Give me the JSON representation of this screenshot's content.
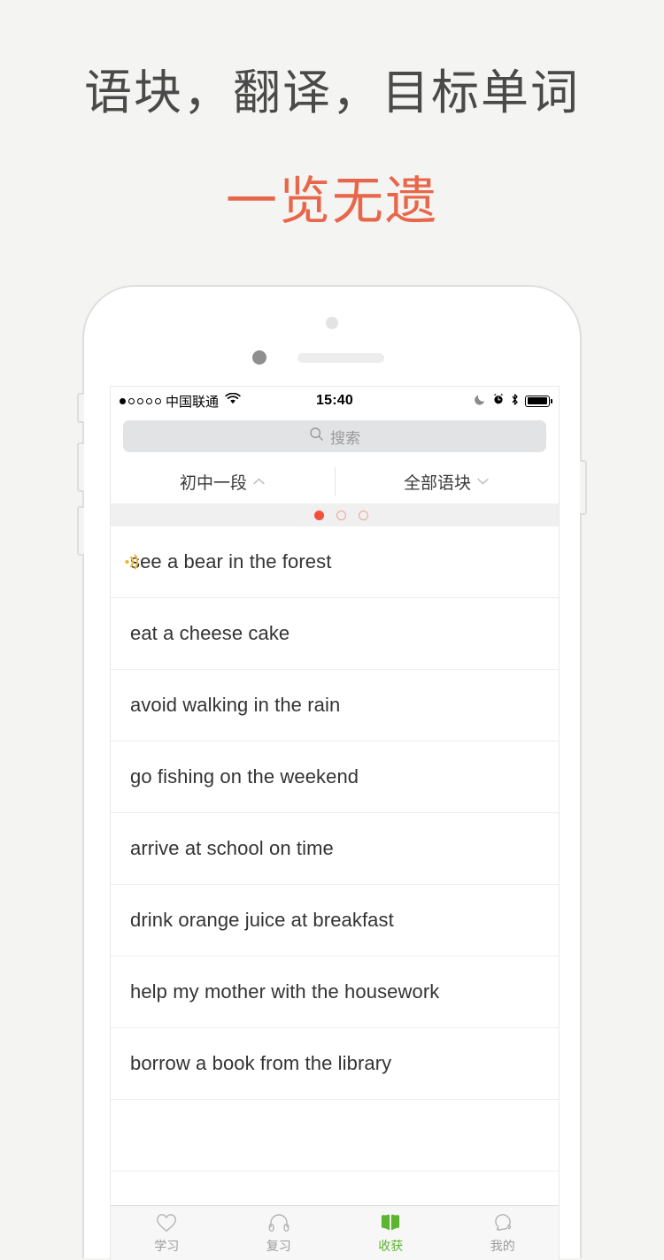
{
  "promo": {
    "line1": "语块，翻译，目标单词",
    "line2": "一览无遗",
    "heading_color": "#4a4a4a",
    "accent_color": "#e8674a"
  },
  "statusbar": {
    "carrier": "中国联通",
    "signal_dots_filled": 1,
    "signal_dots_total": 5,
    "wifi": "wifi-icon",
    "time": "15:40",
    "icons": [
      "moon-icon",
      "alarm-clock-icon",
      "bluetooth-icon",
      "battery-icon"
    ],
    "battery_level": "85"
  },
  "search": {
    "placeholder": "搜索",
    "value": "",
    "icon": "search-icon"
  },
  "filters": [
    {
      "label": "初中一段",
      "chevron": "chevron-up-icon"
    },
    {
      "label": "全部语块",
      "chevron": "chevron-down-icon"
    }
  ],
  "pager": {
    "total": 3,
    "active_index": 0,
    "active_color": "#f4503c",
    "idle_border_color": "#f0a193"
  },
  "list": {
    "items": [
      {
        "text": "see a bear in the forest",
        "speaker": true
      },
      {
        "text": "eat a cheese cake",
        "speaker": false
      },
      {
        "text": "avoid walking in the rain",
        "speaker": false
      },
      {
        "text": "go fishing on the weekend",
        "speaker": false
      },
      {
        "text": "arrive at school on time",
        "speaker": false
      },
      {
        "text": "drink orange juice at breakfast",
        "speaker": false
      },
      {
        "text": "help my mother with the housework",
        "speaker": false
      },
      {
        "text": "borrow a book from the library",
        "speaker": false
      }
    ]
  },
  "tabbar": {
    "active_color": "#5cb531",
    "inactive_color": "#9b9b9b",
    "tabs": [
      {
        "label": "学习",
        "icon": "heart-icon",
        "active": false
      },
      {
        "label": "复习",
        "icon": "headphones-icon",
        "active": false
      },
      {
        "label": "收获",
        "icon": "open-book-icon",
        "active": true
      },
      {
        "label": "我的",
        "icon": "ghost-profile-icon",
        "active": false
      }
    ]
  }
}
